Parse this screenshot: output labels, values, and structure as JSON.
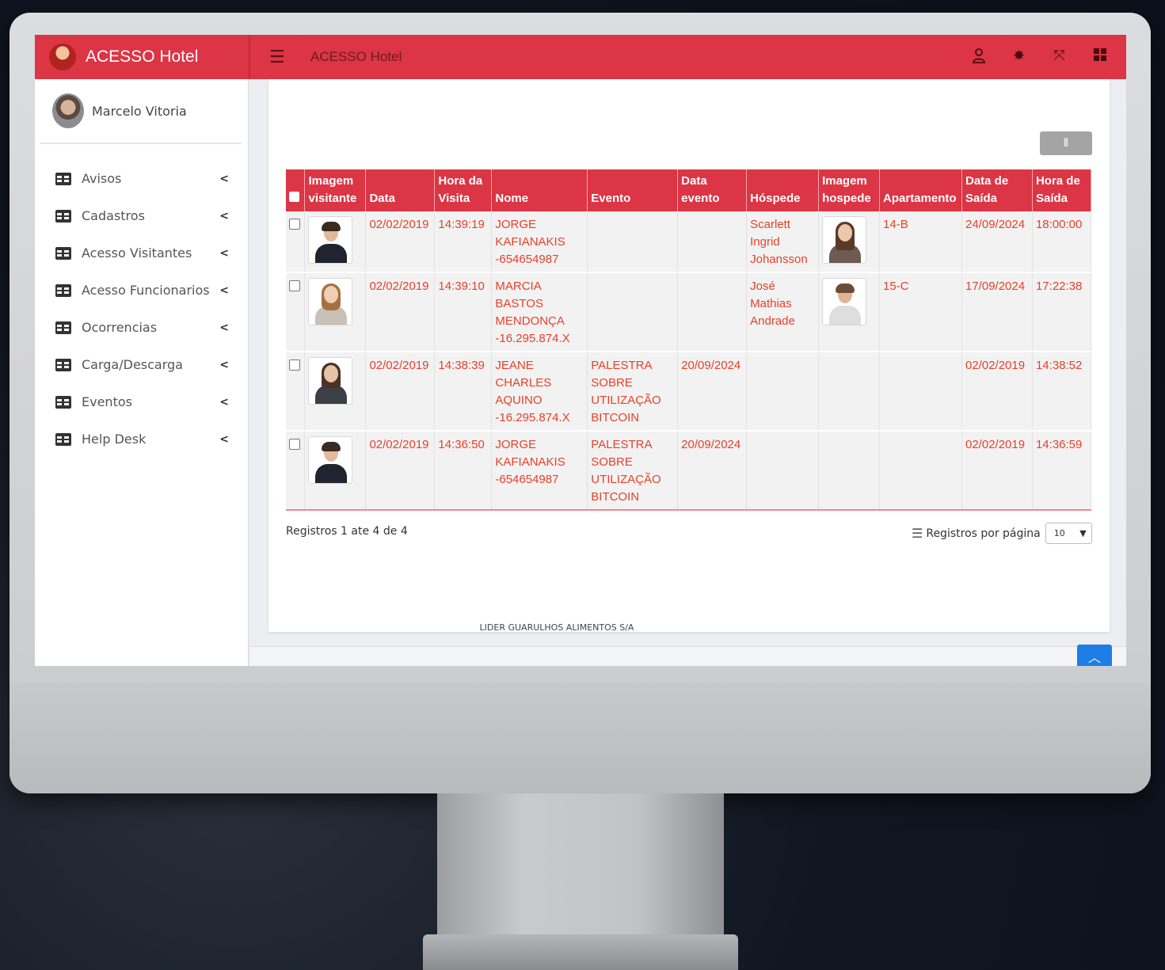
{
  "app": {
    "brand": "ACESSO Hotel",
    "title": "ACESSO Hotel"
  },
  "topbar": {
    "menu_icon": "hamburger-icon",
    "icons": [
      "user-icon",
      "gear-icon",
      "fullscreen-icon",
      "grid-icon"
    ]
  },
  "user": {
    "name": "Marcelo Vitoria"
  },
  "sidebar": {
    "items": [
      {
        "label": "Avisos"
      },
      {
        "label": "Cadastros"
      },
      {
        "label": "Acesso Visitantes"
      },
      {
        "label": "Acesso Funcionarios"
      },
      {
        "label": "Ocorrencias"
      },
      {
        "label": "Carga/Descarga"
      },
      {
        "label": "Eventos"
      },
      {
        "label": "Help Desk"
      }
    ]
  },
  "table": {
    "headers": [
      "Imagem visitante",
      "Data",
      "Hora da Visita",
      "Nome",
      "Evento",
      "Data evento",
      "Hóspede",
      "Imagem hospede",
      "Apartamento",
      "Data de Saída",
      "Hora de Saída"
    ],
    "rows": [
      {
        "data": "02/02/2019",
        "hora": "14:39:19",
        "nome": "JORGE KAFIANAKIS -654654987",
        "evento": "",
        "data_evento": "",
        "hospede": "Scarlett Ingrid Johansson",
        "apartamento": "14-B",
        "data_saida": "24/09/2024",
        "hora_saida": "18:00:00"
      },
      {
        "data": "02/02/2019",
        "hora": "14:39:10",
        "nome": "MARCIA BASTOS MENDONÇA -16.295.874.X",
        "evento": "",
        "data_evento": "",
        "hospede": "José Mathias Andrade",
        "apartamento": "15-C",
        "data_saida": "17/09/2024",
        "hora_saida": "17:22:38"
      },
      {
        "data": "02/02/2019",
        "hora": "14:38:39",
        "nome": "JEANE CHARLES AQUINO -16.295.874.X",
        "evento": "PALESTRA SOBRE UTILIZAÇÃO BITCOIN",
        "data_evento": "20/09/2024",
        "hospede": "",
        "apartamento": "",
        "data_saida": "02/02/2019",
        "hora_saida": "14:38:52"
      },
      {
        "data": "02/02/2019",
        "hora": "14:36:50",
        "nome": "JORGE KAFIANAKIS -654654987",
        "evento": "PALESTRA SOBRE UTILIZAÇÃO BITCOIN",
        "data_evento": "20/09/2024",
        "hospede": "",
        "apartamento": "",
        "data_saida": "02/02/2019",
        "hora_saida": "14:36:59"
      }
    ]
  },
  "pagination": {
    "info": "Registros 1 ate 4 de 4",
    "per_page_label": "Registros por página",
    "per_page_value": "10"
  },
  "footer": {
    "company": "LIDER GUARULHOS ALIMENTOS S/A"
  },
  "colors": {
    "accent": "#dc3545",
    "cell_text": "#e8402a",
    "scroll_button": "#1e7ee6"
  }
}
